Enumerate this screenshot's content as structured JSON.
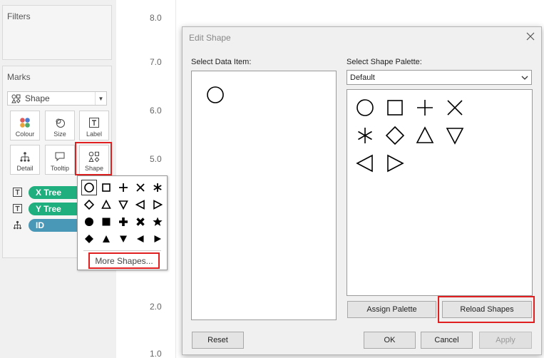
{
  "filters": {
    "title": "Filters"
  },
  "marks": {
    "title": "Marks",
    "mark_type": "Shape",
    "buttons": {
      "colour": "Colour",
      "size": "Size",
      "label": "Label",
      "detail": "Detail",
      "tooltip": "Tooltip",
      "shape": "Shape"
    },
    "pills": [
      "X Tree",
      "Y Tree",
      "ID"
    ]
  },
  "shape_popup": {
    "more_shapes": "More Shapes..."
  },
  "chart": {
    "y_ticks": [
      "8.0",
      "7.0",
      "6.0",
      "5.0",
      "2.0",
      "1.0"
    ]
  },
  "dialog": {
    "title": "Edit Shape",
    "select_data_item": "Select Data Item:",
    "select_shape_palette": "Select Shape Palette:",
    "palette_value": "Default",
    "assign_palette": "Assign Palette",
    "reload_shapes": "Reload Shapes",
    "reset": "Reset",
    "ok": "OK",
    "cancel": "Cancel",
    "apply": "Apply"
  },
  "colors": {
    "highlight": "#e02020",
    "pill_green": "#1fae7e",
    "pill_blue": "#4a98b7"
  }
}
